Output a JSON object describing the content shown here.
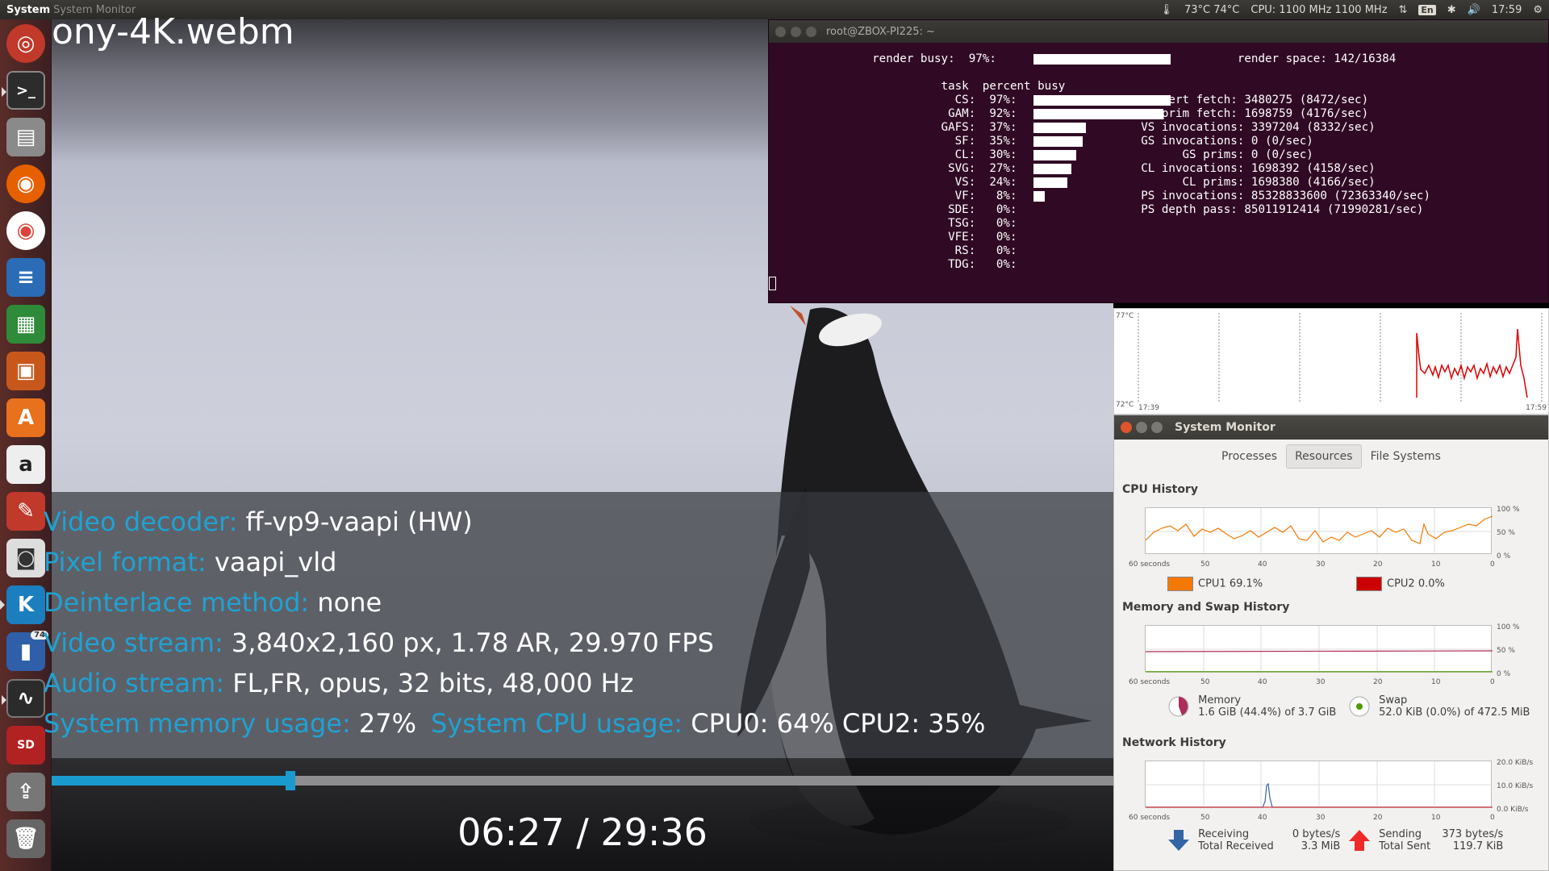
{
  "top_panel": {
    "app": "System",
    "menu": "System Monitor",
    "temp": "73°C 74°C",
    "cpu": "CPU: 1100 MHz 1100 MHz",
    "kb": "En",
    "clock": "17:59"
  },
  "video": {
    "title": "ony-4K.webm",
    "decoder_label": "Video decoder:",
    "decoder_value": "ff-vp9-vaapi (HW)",
    "pixel_label": "Pixel format:",
    "pixel_value": "vaapi_vld",
    "deint_label": "Deinterlace method:",
    "deint_value": "none",
    "vstream_label": "Video stream:",
    "vstream_value": "3,840x2,160 px, 1.78 AR, 29.970 FPS",
    "astream_label": "Audio stream:",
    "astream_value": "FL,FR, opus, 32 bits, 48,000 Hz",
    "mem_label": "System memory usage:",
    "mem_value": "27%",
    "cpu_label": "System CPU usage:",
    "cpu_value": "CPU0:  64% CPU2:  35%",
    "progress": 0.225,
    "time": "06:27 / 29:36"
  },
  "terminal": {
    "title": "root@ZBOX-PI225: ~",
    "text": "               render busy:  97%:                                   render space: 142/16384\n\n                         task  percent busy\n                           CS:  97%:                     vert fetch: 3480275 (8472/sec)\n                          GAM:  92%:                     prim fetch: 1698759 (4176/sec)\n                         GAFS:  37%:                  VS invocations: 3397204 (8332/sec)\n                           SF:  35%:                  GS invocations: 0 (0/sec)\n                           CL:  30%:                        GS prims: 0 (0/sec)\n                          SVG:  27%:                  CL invocations: 1698392 (4158/sec)\n                           VS:  24%:                        CL prims: 1698380 (4166/sec)\n                           VF:   8%:                  PS invocations: 85328833600 (72363340/sec)\n                          SDE:   0%:                  PS depth pass: 85011912414 (71990281/sec)\n                          TSG:   0%:\n                          VFE:   0%:\n                           RS:   0%:\n                          TDG:   0%:",
    "bars": [
      97,
      92,
      37,
      35,
      30,
      27,
      24,
      8
    ]
  },
  "temp_graph": {
    "top_label": "77°C",
    "bottom_label": "72°C",
    "start_time": "17:39",
    "end_time": "17:59"
  },
  "sysmon": {
    "title": "System Monitor",
    "tabs": [
      "Processes",
      "Resources",
      "File Systems"
    ],
    "cpu_history": "CPU History",
    "mem_history": "Memory and Swap History",
    "net_history": "Network History",
    "x_ticks": [
      "60 seconds",
      "50",
      "40",
      "30",
      "20",
      "10",
      "0"
    ],
    "pct_ticks": [
      "100 %",
      "50 %",
      "0 %"
    ],
    "net_ticks": [
      "20.0 KiB/s",
      "10.0 KiB/s",
      "0.0 KiB/s"
    ],
    "cpu1": "CPU1  69.1%",
    "cpu2": "CPU2  0.0%",
    "memory_label": "Memory",
    "memory_value": "1.6 GiB (44.4%) of 3.7 GiB",
    "swap_label": "Swap",
    "swap_value": "52.0 KiB (0.0%) of 472.5 MiB",
    "receiving": "Receiving",
    "receiving_rate": "0 bytes/s",
    "total_received_label": "Total Received",
    "total_received": "3.3 MiB",
    "sending": "Sending",
    "sending_rate": "373 bytes/s",
    "total_sent_label": "Total Sent",
    "total_sent": "119.7 KiB",
    "colors": {
      "cpu1": "#f57900",
      "cpu2": "#cc0000",
      "memory": "#ad2c5a",
      "swap": "#4e9a06",
      "receiving": "#3465a4",
      "sending": "#ef2929"
    }
  }
}
